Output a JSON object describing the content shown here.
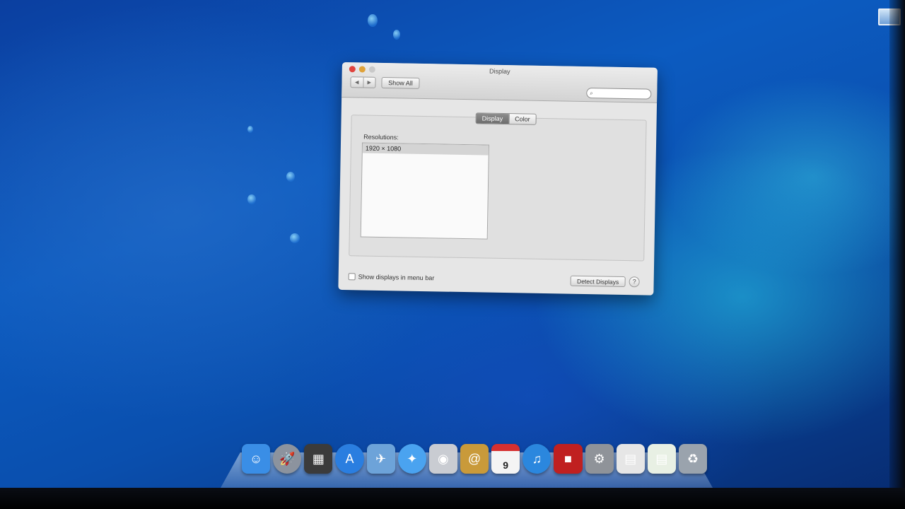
{
  "window": {
    "title": "Display",
    "nav_back": "◀",
    "nav_forward": "▶",
    "show_all_label": "Show All",
    "search_placeholder": "",
    "tabs": [
      {
        "label": "Display",
        "active": true
      },
      {
        "label": "Color",
        "active": false
      }
    ],
    "resolutions_label": "Resolutions:",
    "resolutions": [
      "1920 × 1080"
    ],
    "show_in_menu_bar_label": "Show displays in menu bar",
    "show_in_menu_bar_checked": false,
    "detect_button_label": "Detect Displays",
    "help_label": "?"
  },
  "dock": {
    "calendar_day": "9",
    "items": [
      {
        "name": "finder-icon",
        "glyph": "☺",
        "color": "#3a8ee6"
      },
      {
        "name": "launchpad-icon",
        "glyph": "🚀",
        "color": "#8c939e"
      },
      {
        "name": "mission-control-icon",
        "glyph": "▦",
        "color": "#3b3b3b"
      },
      {
        "name": "app-store-icon",
        "glyph": "A",
        "color": "#2a7ee0"
      },
      {
        "name": "preview-icon",
        "glyph": "✈",
        "color": "#6da3d9"
      },
      {
        "name": "safari-icon",
        "glyph": "✦",
        "color": "#4aa3f0"
      },
      {
        "name": "facetime-icon",
        "glyph": "◉",
        "color": "#c9ccd2"
      },
      {
        "name": "address-book-icon",
        "glyph": "@",
        "color": "#c99a3a"
      },
      {
        "name": "calendar-icon",
        "glyph": "",
        "color": "#f4f4f4"
      },
      {
        "name": "itunes-icon",
        "glyph": "♫",
        "color": "#2b87de"
      },
      {
        "name": "photo-booth-icon",
        "glyph": "■",
        "color": "#c02020"
      },
      {
        "name": "system-preferences-icon",
        "glyph": "⚙",
        "color": "#8f9399"
      },
      {
        "name": "document-icon",
        "glyph": "▤",
        "color": "#e6e6e6"
      },
      {
        "name": "document-green-icon",
        "glyph": "▤",
        "color": "#e8f0e4"
      },
      {
        "name": "trash-icon",
        "glyph": "♻",
        "color": "#9aa3ad"
      }
    ]
  }
}
